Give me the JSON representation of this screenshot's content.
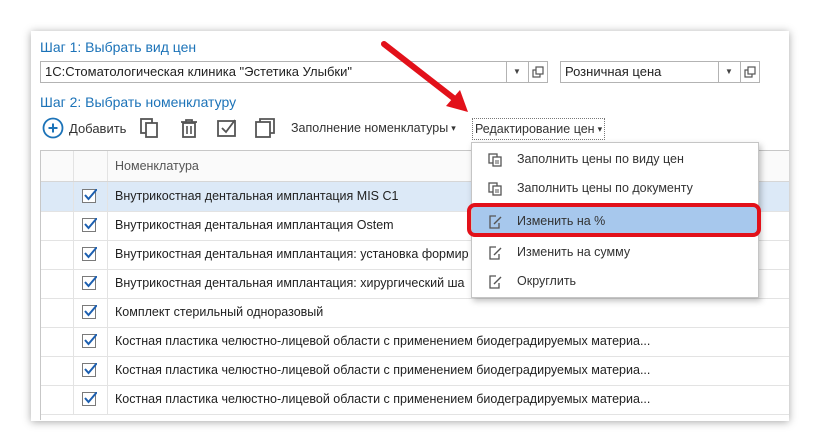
{
  "step1": {
    "title": "Шаг 1: Выбрать вид цен",
    "organization": "1С:Стоматологическая клиника \"Эстетика Улыбки\"",
    "price_type": "Розничная цена"
  },
  "step2": {
    "title": "Шаг 2: Выбрать номенклатуру"
  },
  "toolbar": {
    "add_label": "Добавить",
    "fill_menu_label": "Заполнение номенклатуры",
    "edit_prices_label": "Редактирование цен"
  },
  "table": {
    "header": "Номенклатура",
    "rows": [
      {
        "name": "Внутрикостная дентальная имплантация MIS C1",
        "checked": true
      },
      {
        "name": "Внутрикостная дентальная имплантация Ostem",
        "checked": true
      },
      {
        "name": "Внутрикостная дентальная имплантация: установка формир",
        "checked": true
      },
      {
        "name": "Внутрикостная дентальная имплантация: хирургический ша",
        "checked": true
      },
      {
        "name": "Комплект стерильный одноразовый",
        "checked": true
      },
      {
        "name": "Костная пластика челюстно-лицевой области с применением биодеградируемых материа...",
        "checked": true
      },
      {
        "name": "Костная пластика челюстно-лицевой области с применением биодеградируемых материа...",
        "checked": true
      },
      {
        "name": "Костная пластика челюстно-лицевой области с применением биодеградируемых материа...",
        "checked": true
      }
    ]
  },
  "popup": {
    "items": [
      {
        "label": "Заполнить цены по виду цен",
        "icon": "fill-icon"
      },
      {
        "label": "Заполнить цены по документу",
        "icon": "fill-icon"
      },
      {
        "label": "Изменить на %",
        "icon": "edit-icon"
      },
      {
        "label": "Изменить на сумму",
        "icon": "edit-icon"
      },
      {
        "label": "Округлить",
        "icon": "edit-icon"
      }
    ],
    "highlighted": "Изменить на %"
  },
  "colors": {
    "accent": "#1c73b8",
    "highlight": "#a7c8ed",
    "selected_row": "#dce9f7",
    "annotation": "#e2111a"
  }
}
